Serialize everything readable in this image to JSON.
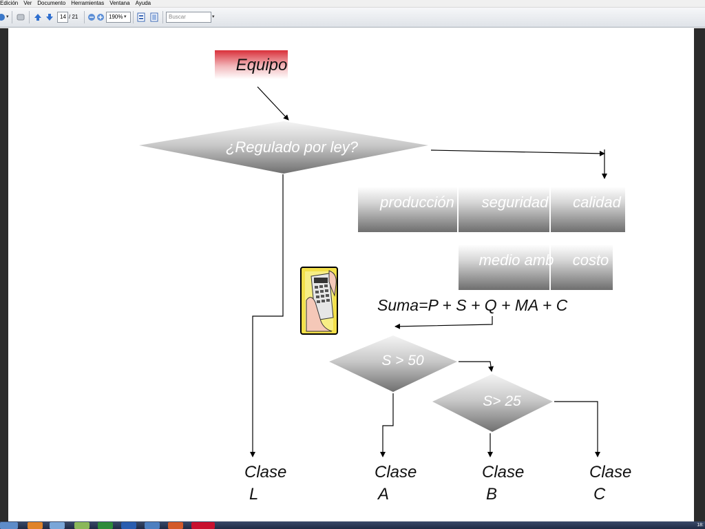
{
  "menu": [
    "Edición",
    "Ver",
    "Documento",
    "Herramientas",
    "Ventana",
    "Ayuda"
  ],
  "toolbar": {
    "page_current": "14",
    "page_total": "/ 21",
    "zoom": "190%",
    "search_placeholder": "Buscar"
  },
  "diagram": {
    "equipo": "Equipo",
    "regulado": "¿Regulado por ley?",
    "criteria_row1": [
      "producción",
      "seguridad",
      "calidad"
    ],
    "criteria_row2": [
      "medio amb",
      "costo"
    ],
    "suma": "Suma=P + S + Q + MA + C",
    "decision1": "S > 50",
    "decision2": "S> 25",
    "clases": [
      {
        "line1": "Clase",
        "line2": "L"
      },
      {
        "line1": "Clase",
        "line2": "A"
      },
      {
        "line1": "Clase",
        "line2": "B"
      },
      {
        "line1": "Clase",
        "line2": "C"
      }
    ]
  },
  "taskbar": {
    "clock": "18:"
  },
  "colors": {
    "equipo_red": "#d9303a",
    "shape_gray": "#8a8a8a"
  }
}
